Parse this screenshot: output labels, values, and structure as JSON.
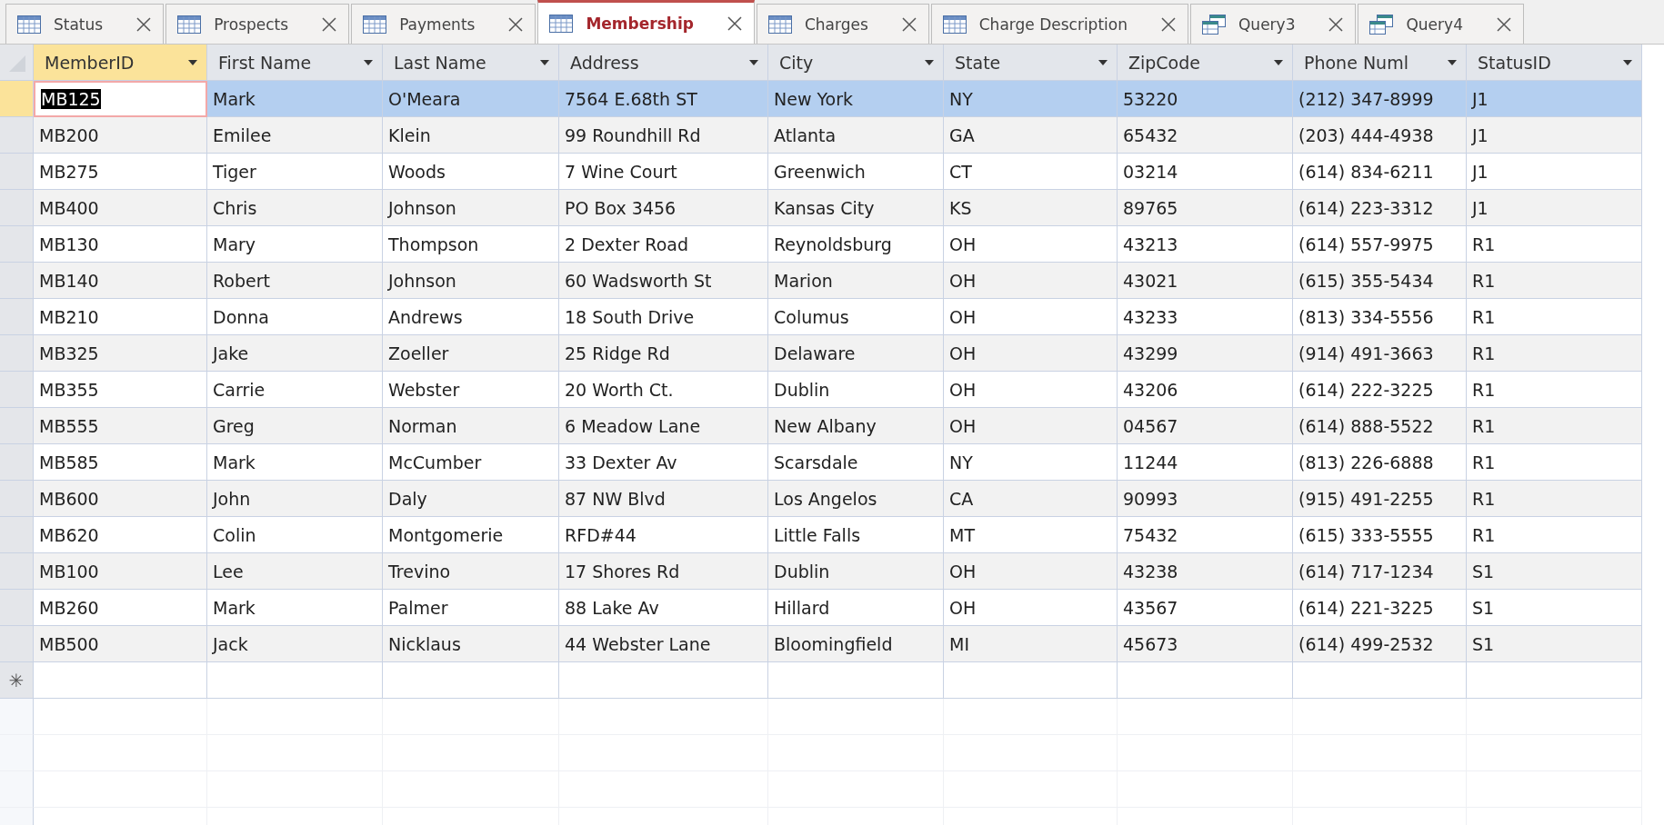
{
  "tabs": [
    {
      "label": "Status",
      "kind": "table",
      "selected": false
    },
    {
      "label": "Prospects",
      "kind": "table",
      "selected": false
    },
    {
      "label": "Payments",
      "kind": "table",
      "selected": false
    },
    {
      "label": "Membership",
      "kind": "table",
      "selected": true
    },
    {
      "label": "Charges",
      "kind": "table",
      "selected": false
    },
    {
      "label": "Charge Description",
      "kind": "table",
      "selected": false
    },
    {
      "label": "Query3",
      "kind": "query",
      "selected": false
    },
    {
      "label": "Query4",
      "kind": "query",
      "selected": false
    }
  ],
  "new_row_marker": "✳",
  "table": {
    "columns": [
      {
        "label": "MemberID",
        "selected": true
      },
      {
        "label": "First Name",
        "selected": false
      },
      {
        "label": "Last Name",
        "selected": false
      },
      {
        "label": "Address",
        "selected": false
      },
      {
        "label": "City",
        "selected": false
      },
      {
        "label": "State",
        "selected": false
      },
      {
        "label": "ZipCode",
        "selected": false
      },
      {
        "label": "Phone Numl",
        "selected": false
      },
      {
        "label": "StatusID",
        "selected": false
      }
    ],
    "rows": [
      {
        "selected": true,
        "cells": [
          "MB125",
          "Mark",
          "O'Meara",
          "7564 E.68th ST",
          "New York",
          "NY",
          "53220",
          "(212) 347-8999",
          "J1"
        ]
      },
      {
        "selected": false,
        "cells": [
          "MB200",
          "Emilee",
          "Klein",
          "99 Roundhill Rd",
          "Atlanta",
          "GA",
          "65432",
          "(203) 444-4938",
          "J1"
        ]
      },
      {
        "selected": false,
        "cells": [
          "MB275",
          "Tiger",
          "Woods",
          "7 Wine Court",
          "Greenwich",
          "CT",
          "03214",
          "(614) 834-6211",
          "J1"
        ]
      },
      {
        "selected": false,
        "cells": [
          "MB400",
          "Chris",
          "Johnson",
          "PO Box 3456",
          "Kansas City",
          "KS",
          "89765",
          "(614) 223-3312",
          "J1"
        ]
      },
      {
        "selected": false,
        "cells": [
          "MB130",
          "Mary",
          "Thompson",
          "2 Dexter Road",
          "Reynoldsburg",
          "OH",
          "43213",
          "(614) 557-9975",
          "R1"
        ]
      },
      {
        "selected": false,
        "cells": [
          "MB140",
          "Robert",
          "Johnson",
          "60 Wadsworth St",
          "Marion",
          "OH",
          "43021",
          "(615) 355-5434",
          "R1"
        ]
      },
      {
        "selected": false,
        "cells": [
          "MB210",
          "Donna",
          "Andrews",
          "18 South Drive",
          "Columus",
          "OH",
          "43233",
          "(813) 334-5556",
          "R1"
        ]
      },
      {
        "selected": false,
        "cells": [
          "MB325",
          "Jake",
          "Zoeller",
          "25 Ridge Rd",
          "Delaware",
          "OH",
          "43299",
          "(914) 491-3663",
          "R1"
        ]
      },
      {
        "selected": false,
        "cells": [
          "MB355",
          "Carrie",
          "Webster",
          "20 Worth Ct.",
          "Dublin",
          "OH",
          "43206",
          "(614) 222-3225",
          "R1"
        ]
      },
      {
        "selected": false,
        "cells": [
          "MB555",
          "Greg",
          "Norman",
          "6 Meadow Lane",
          "New Albany",
          "OH",
          "04567",
          "(614) 888-5522",
          "R1"
        ]
      },
      {
        "selected": false,
        "cells": [
          "MB585",
          "Mark",
          "McCumber",
          "33 Dexter Av",
          "Scarsdale",
          "NY",
          "11244",
          "(813) 226-6888",
          "R1"
        ]
      },
      {
        "selected": false,
        "cells": [
          "MB600",
          "John",
          "Daly",
          "87 NW Blvd",
          "Los Angelos",
          "CA",
          "90993",
          "(915) 491-2255",
          "R1"
        ]
      },
      {
        "selected": false,
        "cells": [
          "MB620",
          "Colin",
          "Montgomerie",
          "RFD#44",
          "Little Falls",
          "MT",
          "75432",
          "(615) 333-5555",
          "R1"
        ]
      },
      {
        "selected": false,
        "cells": [
          "MB100",
          "Lee",
          "Trevino",
          "17 Shores Rd",
          "Dublin",
          "OH",
          "43238",
          "(614) 717-1234",
          "S1"
        ]
      },
      {
        "selected": false,
        "cells": [
          "MB260",
          "Mark",
          "Palmer",
          "88 Lake Av",
          "Hillard",
          "OH",
          "43567",
          "(614) 221-3225",
          "S1"
        ]
      },
      {
        "selected": false,
        "cells": [
          "MB500",
          "Jack",
          "Nicklaus",
          "44 Webster Lane",
          "Bloomingfield",
          "MI",
          "45673",
          "(614) 499-2532",
          "S1"
        ]
      }
    ]
  }
}
